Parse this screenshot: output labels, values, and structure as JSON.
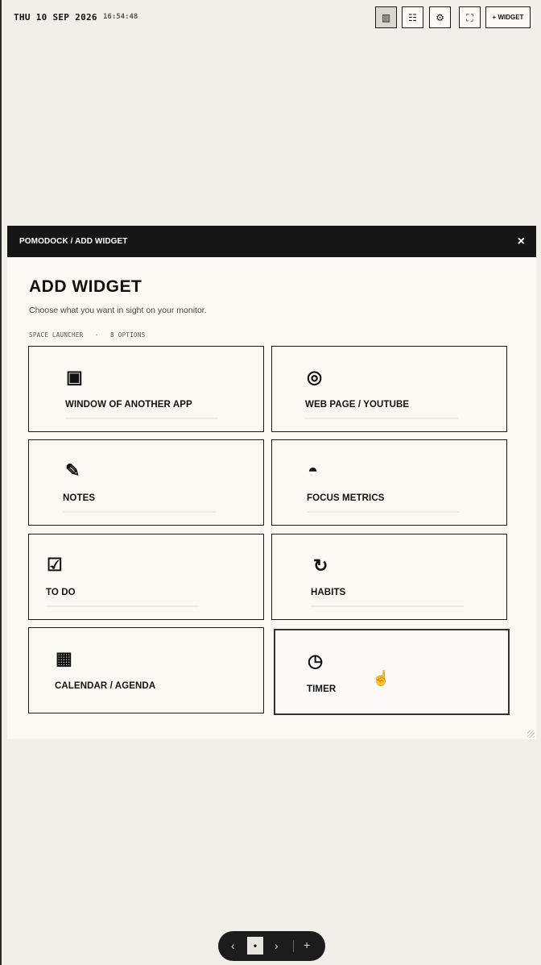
{
  "topbar": {
    "date": "THU 10 SEP 2026",
    "time": "16:54:48",
    "buttons": [
      {
        "name": "grid-view-icon",
        "glyph": "▥"
      },
      {
        "name": "list-view-icon",
        "glyph": "☷"
      },
      {
        "name": "settings-gear-icon",
        "glyph": "⚙"
      },
      {
        "name": "fullscreen-icon",
        "glyph": "⛶"
      }
    ],
    "widget_label": "+ WIDGET"
  },
  "modal": {
    "breadcrumb": "POMODOCK / ADD WIDGET",
    "close": "×",
    "title": "ADD WIDGET",
    "subtitle": "Choose what you want in sight on your monitor.",
    "meta": "SPACE LAUNCHER   ·   8 OPTIONS",
    "cards": [
      {
        "icon": "▣",
        "icon_name": "window-icon",
        "label": "WINDOW OF ANOTHER APP"
      },
      {
        "icon": "◎",
        "icon_name": "web-page-icon",
        "label": "WEB PAGE / YOUTUBE"
      },
      {
        "icon": "✎",
        "icon_name": "pencil-icon",
        "label": "NOTES"
      },
      {
        "icon": "◓",
        "icon_name": "half-circle-icon",
        "label": "FOCUS METRICS"
      },
      {
        "icon": "☑",
        "icon_name": "checkbox-icon",
        "label": "TO DO"
      },
      {
        "icon": "↻",
        "icon_name": "refresh-icon",
        "label": "HABITS"
      },
      {
        "icon": "▦",
        "icon_name": "calendar-grid-icon",
        "label": "CALENDAR / AGENDA"
      },
      {
        "icon": "◷",
        "icon_name": "clock-icon",
        "label": "TIMER"
      }
    ]
  },
  "pager": {
    "prev": "‹",
    "current": "•",
    "next": "›",
    "add": "+"
  }
}
